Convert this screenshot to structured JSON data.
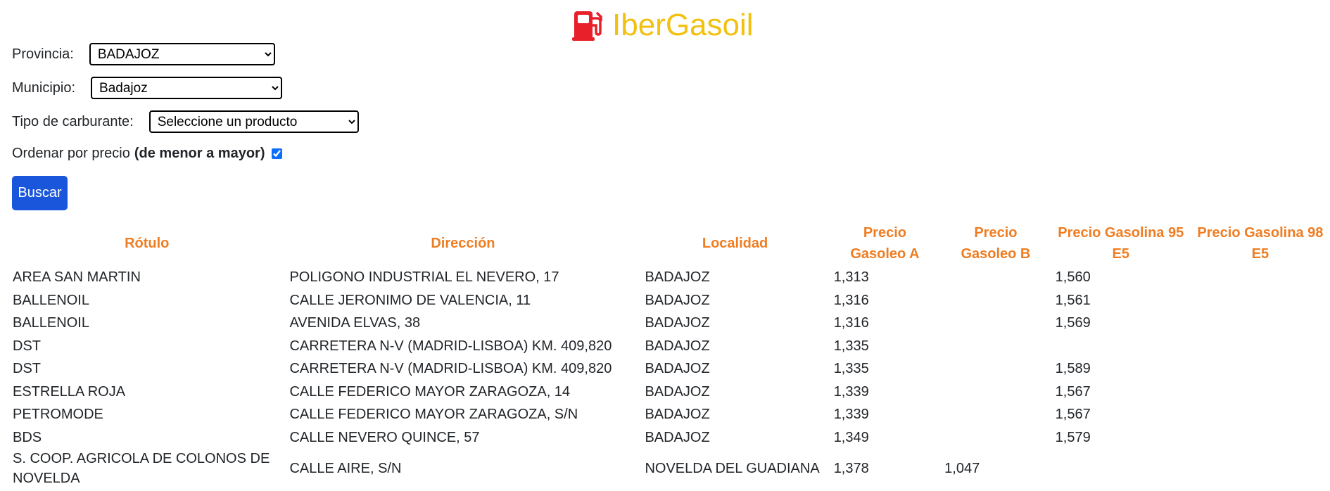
{
  "brand": {
    "name": "IberGasoil",
    "icon": "fuel-pump-icon",
    "icon_color": "#e8202a",
    "text_color": "#f2c00f"
  },
  "filters": {
    "provincia": {
      "label": "Provincia:",
      "value": "BADAJOZ"
    },
    "municipio": {
      "label": "Municipio:",
      "value": "Badajoz"
    },
    "tipo": {
      "label": "Tipo de carburante:",
      "value": "Seleccione un producto"
    },
    "order": {
      "label": "Ordenar por precio",
      "label_bold": "(de menor a mayor)",
      "checked": true
    }
  },
  "search_button": {
    "label": "Buscar",
    "color": "#1a56db"
  },
  "table": {
    "header_color": "#ef7d22",
    "columns": [
      "Rótulo",
      "Dirección",
      "Localidad",
      "Precio Gasoleo A",
      "Precio Gasoleo B",
      "Precio Gasolina 95 E5",
      "Precio Gasolina 98 E5"
    ],
    "rows": [
      [
        "AREA SAN MARTIN",
        "POLIGONO INDUSTRIAL EL NEVERO, 17",
        "BADAJOZ",
        "1,313",
        "",
        "1,560",
        ""
      ],
      [
        "BALLENOIL",
        "CALLE JERONIMO DE VALENCIA, 11",
        "BADAJOZ",
        "1,316",
        "",
        "1,561",
        ""
      ],
      [
        "BALLENOIL",
        "AVENIDA ELVAS, 38",
        "BADAJOZ",
        "1,316",
        "",
        "1,569",
        ""
      ],
      [
        "DST",
        "CARRETERA N-V (MADRID-LISBOA) KM. 409,820",
        "BADAJOZ",
        "1,335",
        "",
        "",
        ""
      ],
      [
        "DST",
        "CARRETERA N-V (MADRID-LISBOA) KM. 409,820",
        "BADAJOZ",
        "1,335",
        "",
        "1,589",
        ""
      ],
      [
        "ESTRELLA ROJA",
        "CALLE FEDERICO MAYOR ZARAGOZA, 14",
        "BADAJOZ",
        "1,339",
        "",
        "1,567",
        ""
      ],
      [
        "PETROMODE",
        "CALLE FEDERICO MAYOR ZARAGOZA, S/N",
        "BADAJOZ",
        "1,339",
        "",
        "1,567",
        ""
      ],
      [
        "BDS",
        "CALLE NEVERO QUINCE, 57",
        "BADAJOZ",
        "1,349",
        "",
        "1,579",
        ""
      ],
      [
        "S. COOP. AGRICOLA DE COLONOS DE NOVELDA",
        "CALLE AIRE, S/N",
        "NOVELDA DEL GUADIANA",
        "1,378",
        "1,047",
        "",
        ""
      ]
    ]
  }
}
